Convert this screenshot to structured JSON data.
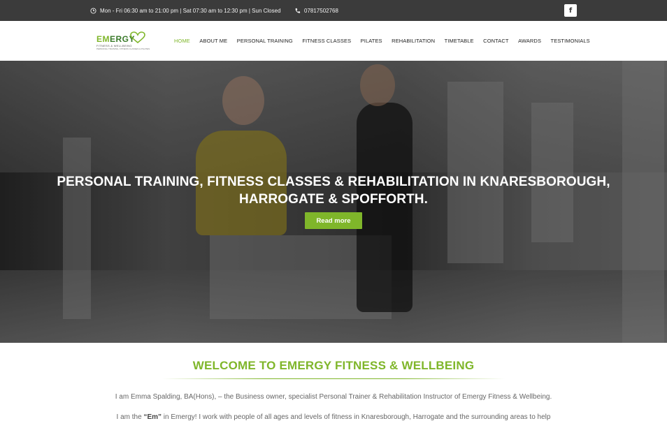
{
  "topbar": {
    "hours": "Mon - Fri 06:30 am to 21:00 pm | Sat 07:30 am to 12:30 pm | Sun Closed",
    "phone": "07817502768",
    "facebook": "f"
  },
  "logo": {
    "em": "EM",
    "rest": "ERGY",
    "tagline": "FITNESS & WELLBEING",
    "subtagline": "PERSONAL TRAINING, FITNESS CLASSES & PILATES"
  },
  "nav": {
    "items": [
      "HOME",
      "ABOUT ME",
      "PERSONAL TRAINING",
      "FITNESS CLASSES",
      "PILATES",
      "REHABILITATION",
      "TIMETABLE",
      "CONTACT",
      "AWARDS",
      "TESTIMONIALS"
    ],
    "active": "HOME"
  },
  "hero": {
    "title_line1": "PERSONAL TRAINING, FITNESS CLASSES & REHABILITATION IN KNARESBOROUGH,",
    "title_line2": "HARROGATE & SPOFFORTH.",
    "button": "Read more"
  },
  "welcome": {
    "title": "WELCOME TO EMERGY FITNESS & WELLBEING",
    "para1": "I am Emma Spalding, BA(Hons), – the Business owner, specialist Personal Trainer & Rehabilitation Instructor of Emergy Fitness & Wellbeing.",
    "para2_prefix": "I am the ",
    "para2_bold": "“Em”",
    "para2_rest": " in Emergy! I work with people of all ages and levels of fitness in Knaresborough, Harrogate and the surrounding areas to help"
  },
  "colors": {
    "accent": "#7fb62a",
    "topbar": "#3b3b3b"
  }
}
